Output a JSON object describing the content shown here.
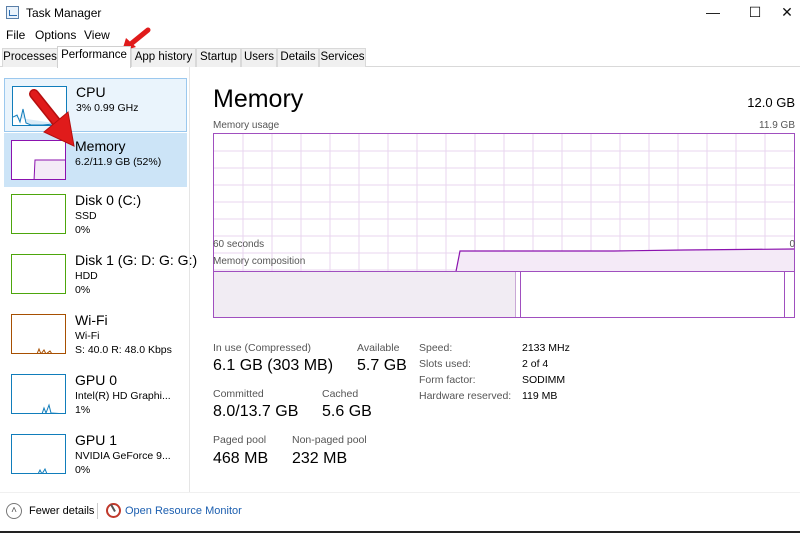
{
  "window": {
    "title": "Task Manager",
    "minimize": "—",
    "maximize": "☐",
    "close": "✕"
  },
  "menu": [
    "File",
    "Options",
    "View"
  ],
  "tabs": [
    "Processes",
    "Performance",
    "App history",
    "Startup",
    "Users",
    "Details",
    "Services"
  ],
  "active_tab": "Performance",
  "sidebar": [
    {
      "title": "CPU",
      "lines": [
        "3% 0.99 GHz"
      ],
      "color": "#117dbb"
    },
    {
      "title": "Memory",
      "lines": [
        "6.2/11.9 GB (52%)"
      ],
      "color": "#8b12ae"
    },
    {
      "title": "Disk 0 (C:)",
      "lines": [
        "SSD",
        "0%"
      ],
      "color": "#4da60c"
    },
    {
      "title": "Disk 1 (G: D: G: G:)",
      "lines": [
        "HDD",
        "0%"
      ],
      "color": "#4da60c"
    },
    {
      "title": "Wi-Fi",
      "lines": [
        "Wi-Fi",
        "S: 40.0  R: 48.0 Kbps"
      ],
      "color": "#a74f01"
    },
    {
      "title": "GPU 0",
      "lines": [
        "Intel(R) HD Graphi...",
        "1%"
      ],
      "color": "#117dbb"
    },
    {
      "title": "GPU 1",
      "lines": [
        "NVIDIA GeForce 9...",
        "0%"
      ],
      "color": "#117dbb"
    }
  ],
  "main": {
    "title": "Memory",
    "total": "12.0 GB",
    "usage_label": "Memory usage",
    "usage_max": "11.9 GB",
    "time_left": "60 seconds",
    "time_right": "0",
    "composition_label": "Memory composition",
    "in_use_fraction": 0.52,
    "stats": {
      "in_use_label": "In use (Compressed)",
      "in_use": "6.1 GB (303 MB)",
      "available_label": "Available",
      "available": "5.7 GB",
      "committed_label": "Committed",
      "committed": "8.0/13.7 GB",
      "cached_label": "Cached",
      "cached": "5.6 GB",
      "paged_label": "Paged pool",
      "paged": "468 MB",
      "nonpaged_label": "Non-paged pool",
      "nonpaged": "232 MB"
    },
    "details": [
      {
        "label": "Speed:",
        "value": "2133 MHz"
      },
      {
        "label": "Slots used:",
        "value": "2 of 4"
      },
      {
        "label": "Form factor:",
        "value": "SODIMM"
      },
      {
        "label": "Hardware reserved:",
        "value": "119 MB"
      }
    ]
  },
  "footer": {
    "fewer": "Fewer details",
    "link": "Open Resource Monitor"
  },
  "colors": {
    "memory": "#8b12ae",
    "annotation_arrow": "#e01b1b"
  }
}
